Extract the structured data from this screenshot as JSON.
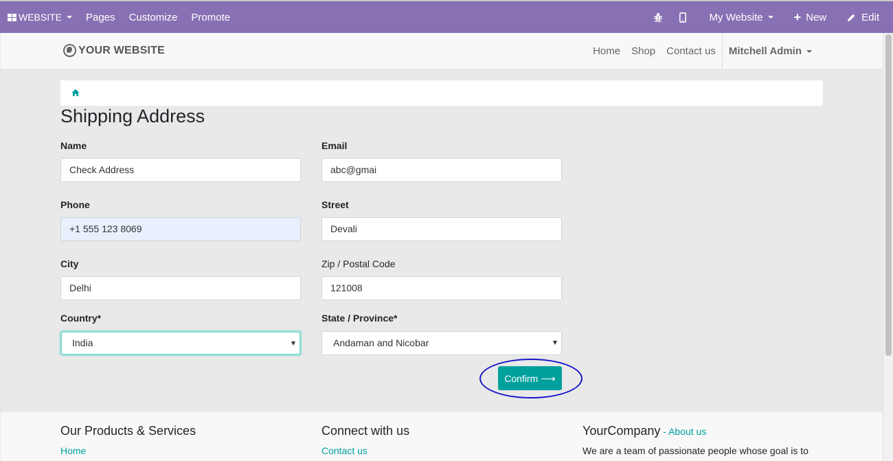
{
  "topbar": {
    "brand": "WEBSITE",
    "menu": [
      "Pages",
      "Customize",
      "Promote"
    ],
    "site_selector": "My Website",
    "new_label": "New",
    "edit_label": "Edit"
  },
  "header": {
    "logo_text": "YOUR WEBSITE",
    "nav": [
      "Home",
      "Shop",
      "Contact us"
    ],
    "user": "Mitchell Admin"
  },
  "page": {
    "title": "Shipping Address"
  },
  "form": {
    "name": {
      "label": "Name",
      "value": "Check Address"
    },
    "email": {
      "label": "Email",
      "value": "abc@gmai"
    },
    "phone": {
      "label": "Phone",
      "value": "+1 555 123 8069"
    },
    "street": {
      "label": "Street",
      "value": "Devali"
    },
    "city": {
      "label": "City",
      "value": "Delhi"
    },
    "zip": {
      "label": "Zip / Postal Code",
      "value": "121008"
    },
    "country": {
      "label": "Country*",
      "value": "India"
    },
    "state": {
      "label": "State / Province*",
      "value": "Andaman and Nicobar"
    },
    "confirm_label": "Confirm"
  },
  "footer": {
    "col1_title": "Our Products & Services",
    "col1_link": "Home",
    "col2_title": "Connect with us",
    "col2_link": "Contact us",
    "col3_title": "YourCompany",
    "col3_link": "About us",
    "col3_text": "We are a team of passionate people whose goal is to"
  },
  "colors": {
    "topbar": "#8771b4",
    "accent": "#00a09d",
    "highlight_ring": "#1414c8"
  }
}
